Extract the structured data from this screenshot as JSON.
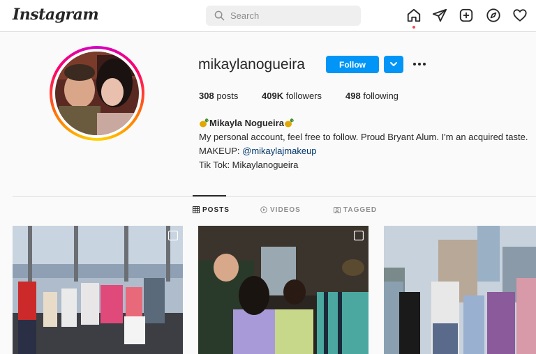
{
  "app": {
    "logo_text": "Instagram"
  },
  "search": {
    "placeholder": "Search"
  },
  "nav": {
    "icons": [
      "home-icon",
      "direct-icon",
      "new-post-icon",
      "explore-icon",
      "activity-icon"
    ]
  },
  "profile": {
    "username": "mikaylanogueira",
    "follow_label": "Follow",
    "stats": {
      "posts_count": "308",
      "posts_label": "posts",
      "followers_count": "409K",
      "followers_label": "followers",
      "following_count": "498",
      "following_label": "following"
    },
    "bio": {
      "display_name": "Mikayla Nogueira",
      "line1": "My personal account, feel free to follow. Proud Bryant Alum. I'm an acquired taste.",
      "line2_prefix": "MAKEUP: ",
      "line2_link": "@mikaylajmakeup",
      "line3": "Tik Tok: Mikaylanogueira"
    }
  },
  "tabs": [
    {
      "label": "POSTS",
      "active": true
    },
    {
      "label": "VIDEOS",
      "active": false
    },
    {
      "label": "TAGGED",
      "active": false
    }
  ],
  "colors": {
    "accent": "#0095f6",
    "link": "#00376b",
    "notification_dot": "#ed4956"
  }
}
